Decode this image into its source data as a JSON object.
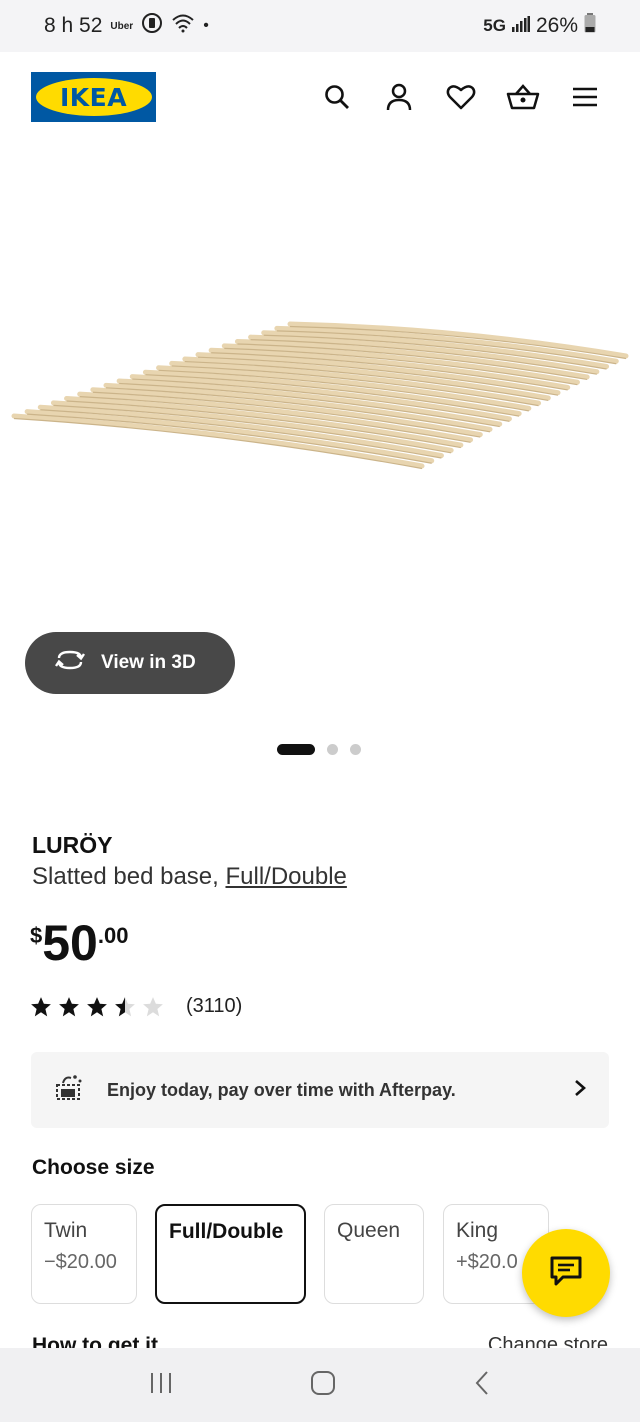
{
  "status_bar": {
    "time": "8 h 52",
    "uber": "Uber",
    "dot": "•",
    "network": "5G",
    "battery": "26%"
  },
  "header": {
    "logo_text": "IKEA",
    "icons": [
      "search-icon",
      "account-icon",
      "heart-icon",
      "cart-icon",
      "menu-icon"
    ]
  },
  "view3d": {
    "label": "View in 3D"
  },
  "carousel": {
    "active_index": 0,
    "count": 3
  },
  "product": {
    "name": "LURÖY",
    "description": "Slatted bed base, ",
    "size_link": "Full/Double",
    "price_currency": "$",
    "price_int": "50",
    "price_dec": ".00",
    "rating_stars": 3.5,
    "rating_max": 5,
    "review_count": "(3110)"
  },
  "afterpay": {
    "text": "Enjoy today, pay over time with Afterpay."
  },
  "sizes": {
    "heading": "Choose size",
    "options": [
      {
        "label": "Twin",
        "diff": "−$20.00"
      },
      {
        "label": "Full/Double",
        "diff": ""
      },
      {
        "label": "Queen",
        "diff": ""
      },
      {
        "label": "King",
        "diff": "+$20.0"
      }
    ],
    "selected": "Full/Double"
  },
  "get_it": {
    "heading": "How to get it",
    "change_store": "Change store"
  },
  "colors": {
    "ikea_blue": "#0058a3",
    "ikea_yellow": "#ffdb00",
    "button_dark": "#484848"
  }
}
